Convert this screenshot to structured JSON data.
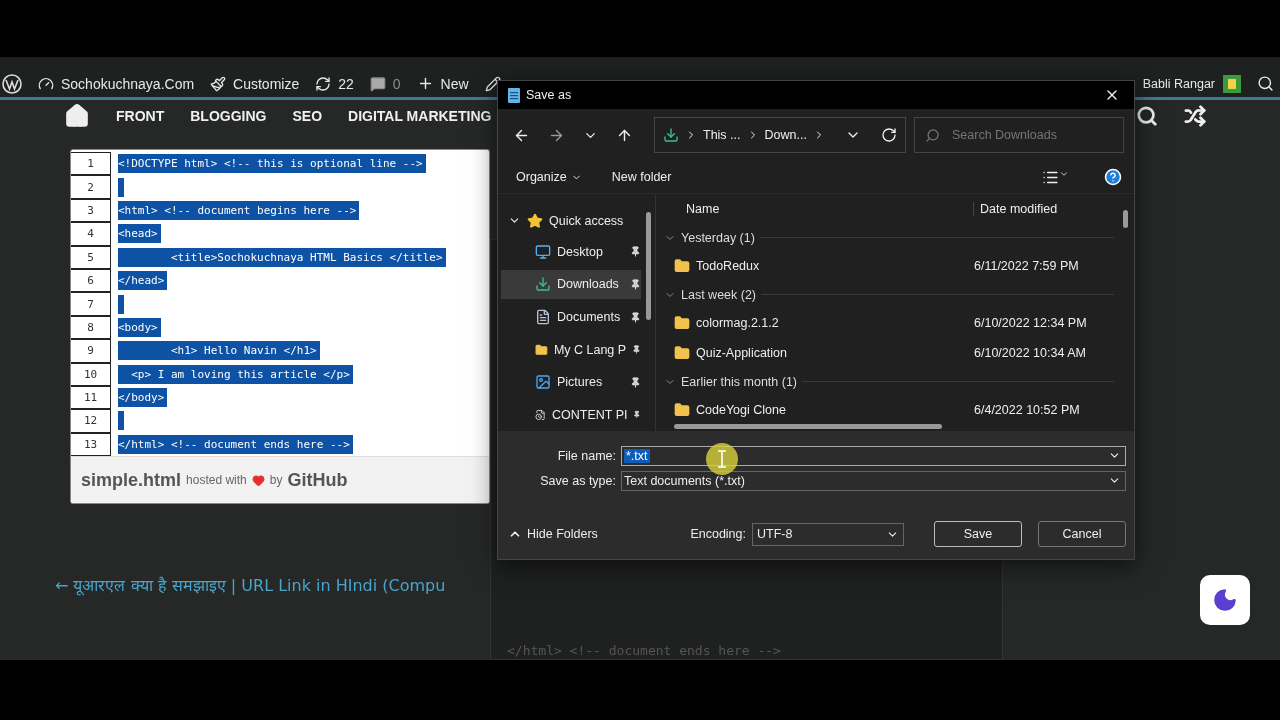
{
  "admin_bar": {
    "items": [
      {
        "kind": "site",
        "label": "Sochokuchnaya.Com"
      },
      {
        "kind": "customize",
        "label": "Customize"
      },
      {
        "kind": "updates",
        "label": "22"
      },
      {
        "kind": "comments",
        "label": "0"
      },
      {
        "kind": "new",
        "label": "New"
      }
    ],
    "user": "Babli Rangar"
  },
  "nav": {
    "items": [
      "FRONT",
      "BLOGGING",
      "SEO",
      "DIGITAL MARKETING"
    ]
  },
  "gist": {
    "lines": [
      {
        "number": "1",
        "code": "<!DOCTYPE html> <!-- this is optional line -->",
        "selected": true
      },
      {
        "number": "2",
        "selected": true
      },
      {
        "number": "3",
        "code": "<html> <!-- document begins here -->",
        "selected": true
      },
      {
        "number": "4",
        "code": "<head>",
        "selected": true
      },
      {
        "number": "5",
        "code": "        <title>Sochokuchnaya HTML Basics </title>",
        "selected": true
      },
      {
        "number": "6",
        "code": "</head>",
        "selected": true
      },
      {
        "number": "7",
        "selected": true
      },
      {
        "number": "8",
        "code": "<body>",
        "selected": true
      },
      {
        "number": "9",
        "code": "        <h1> Hello Navin </h1>",
        "selected": true
      },
      {
        "number": "10",
        "code": "  <p> I am loving this article </p>",
        "selected": true
      },
      {
        "number": "11",
        "code": "</body>",
        "selected": true
      },
      {
        "number": "12",
        "selected": true
      },
      {
        "number": "13",
        "code": "</html> <!-- document ends here -->",
        "selected": true
      }
    ],
    "file": "simple.html",
    "hosted": "hosted with",
    "by": "by",
    "host": "GitHub"
  },
  "behind_code": "</html> <!-- document ends here -->",
  "previous_link": "← यूआरएल क्या है समझाइए | URL Link in HIndi (Compu",
  "dialog": {
    "title": "Save as",
    "breadcrumb": [
      "This ...",
      "Down..."
    ],
    "search": {
      "placeholder": "Search Downloads"
    },
    "commands": [
      {
        "label": "Organize",
        "dropdown": true
      },
      {
        "label": "New folder",
        "dropdown": false
      }
    ],
    "nav_pane": {
      "label": "Quick access",
      "expanded": true,
      "children": [
        {
          "kind": "desktop",
          "label": "Desktop",
          "selected": false
        },
        {
          "kind": "downloads",
          "label": "Downloads",
          "selected": true
        },
        {
          "kind": "documents",
          "label": "Documents",
          "selected": false
        },
        {
          "kind": "folder",
          "label": "My C Lang P",
          "selected": false
        },
        {
          "kind": "pictures",
          "label": "Pictures",
          "selected": false
        },
        {
          "kind": "file",
          "label": "CONTENT PI",
          "selected": false
        }
      ]
    },
    "columns": [
      "Name",
      "Date modified"
    ],
    "groups": [
      {
        "label": "Yesterday (1)",
        "expanded": true,
        "files": [
          {
            "name": "TodoRedux",
            "date": "6/11/2022 7:59 PM"
          }
        ]
      },
      {
        "label": "Last week (2)",
        "expanded": true,
        "files": [
          {
            "name": "colormag.2.1.2",
            "date": "6/10/2022 12:34 PM"
          },
          {
            "name": "Quiz-Application",
            "date": "6/10/2022 10:34 AM"
          }
        ]
      },
      {
        "label": "Earlier this month (1)",
        "expanded": true,
        "files": [
          {
            "name": "CodeYogi Clone",
            "date": "6/4/2022 10:52 PM"
          }
        ]
      }
    ],
    "file_name": {
      "label": "File name:",
      "value": "*.txt"
    },
    "save_type": {
      "label": "Save as type:",
      "value": "Text documents (*.txt)"
    },
    "hide_folders": "Hide Folders",
    "encoding": {
      "label": "Encoding:",
      "value": "UTF-8"
    },
    "buttons": [
      "Save",
      "Cancel"
    ]
  }
}
